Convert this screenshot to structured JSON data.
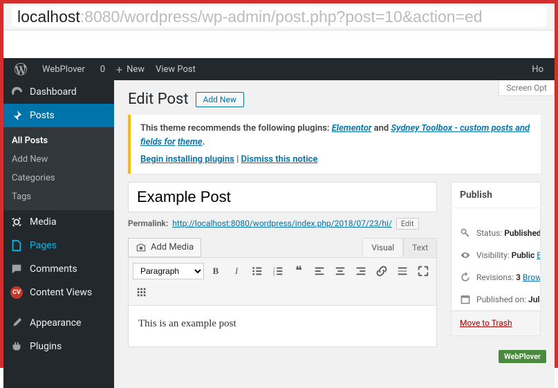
{
  "url": {
    "host": "localhost",
    "rest": ":8080/wordpress/wp-admin/post.php?post=10&action=ed"
  },
  "adminbar": {
    "site": "WebPlover",
    "comments": "0",
    "new": "New",
    "viewpost": "View Post",
    "howdy": "Ho"
  },
  "sidebar": {
    "dashboard": "Dashboard",
    "posts": "Posts",
    "posts_sub": {
      "all": "All Posts",
      "add": "Add New",
      "cats": "Categories",
      "tags": "Tags"
    },
    "media": "Media",
    "pages": "Pages",
    "comments": "Comments",
    "cv": "Content Views",
    "cv_badge": "CV",
    "appearance": "Appearance",
    "plugins": "Plugins"
  },
  "content": {
    "screen_options": "Screen Opt",
    "heading": "Edit Post",
    "addnew": "Add New",
    "notice": {
      "lead": "This theme recommends the following plugins: ",
      "plugin1": "Elementor",
      "and": " and ",
      "plugin2": "Sydney Toolbox - custom posts and fields for",
      "plugin2b": "theme",
      "begin": "Begin installing plugins",
      "sep": " | ",
      "dismiss": "Dismiss this notice"
    },
    "title": "Example Post",
    "permalink_label": "Permalink:",
    "permalink_url": "http://localhost:8080/wordpress/index.php/2018/07/23/hi/",
    "edit": "Edit",
    "add_media": "Add Media",
    "tab_visual": "Visual",
    "tab_text": "Text",
    "paragraph": "Paragraph",
    "body": "This is an example post"
  },
  "publish": {
    "title": "Publish",
    "status_lbl": "Status:",
    "status_val": "Published",
    "vis_lbl": "Visibility:",
    "vis_val": "Public",
    "vis_edit": "E",
    "rev_lbl": "Revisions:",
    "rev_val": "3",
    "rev_browse": "Brow",
    "pub_lbl": "Published on:",
    "pub_val": "Jul",
    "trash": "Move to Trash"
  },
  "watermark": "WebPlover"
}
